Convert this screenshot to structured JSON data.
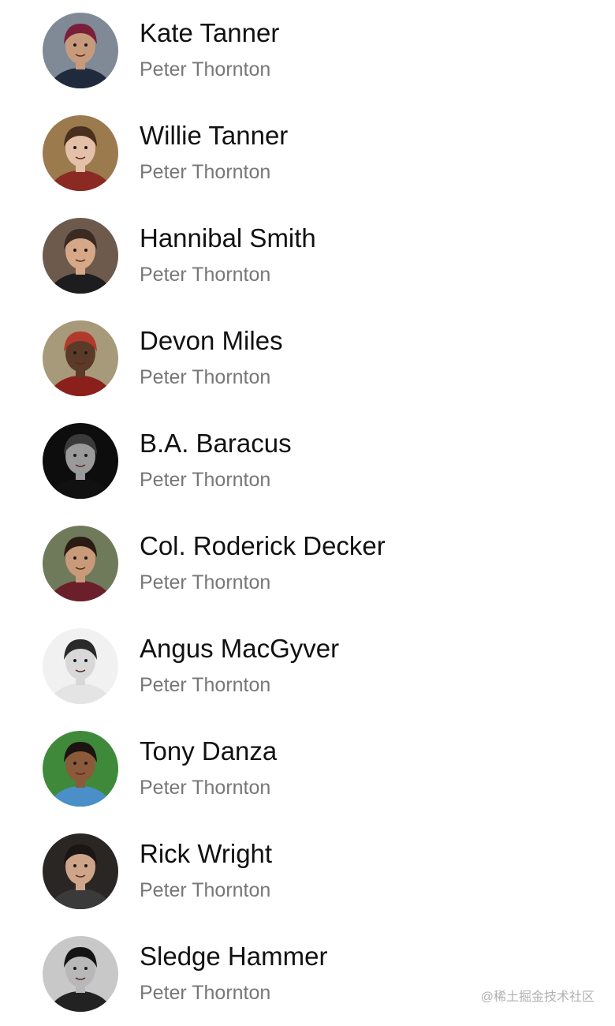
{
  "contacts": [
    {
      "name": "Kate Tanner",
      "subtitle": "Peter Thornton",
      "avatar": {
        "bg": "#7f8a96",
        "skin": "#c89a7c",
        "hair": "#7a1f3a",
        "shirt": "#1f2b3d"
      }
    },
    {
      "name": "Willie Tanner",
      "subtitle": "Peter Thornton",
      "avatar": {
        "bg": "#9b7a4e",
        "skin": "#e5c0a8",
        "hair": "#4a2f1e",
        "shirt": "#8a2a22"
      }
    },
    {
      "name": "Hannibal Smith",
      "subtitle": "Peter Thornton",
      "avatar": {
        "bg": "#6d5a4c",
        "skin": "#d7a888",
        "hair": "#3a2b22",
        "shirt": "#1d1d1f"
      }
    },
    {
      "name": "Devon Miles",
      "subtitle": "Peter Thornton",
      "avatar": {
        "bg": "#a79a7a",
        "skin": "#5c3a28",
        "hair": "#b23a2c",
        "shirt": "#8a1f1c"
      }
    },
    {
      "name": "B.A. Baracus",
      "subtitle": "Peter Thornton",
      "avatar": {
        "bg": "#0d0d0d",
        "skin": "#9a9a9a",
        "hair": "#3a3a3a",
        "shirt": "#111111"
      }
    },
    {
      "name": "Col. Roderick Decker",
      "subtitle": "Peter Thornton",
      "avatar": {
        "bg": "#6f7a5a",
        "skin": "#c99a7a",
        "hair": "#2a1c14",
        "shirt": "#6a1f2a"
      }
    },
    {
      "name": "Angus MacGyver",
      "subtitle": "Peter Thornton",
      "avatar": {
        "bg": "#f1f1f1",
        "skin": "#d8d8d8",
        "hair": "#2a2a2a",
        "shirt": "#e4e4e4"
      }
    },
    {
      "name": "Tony Danza",
      "subtitle": "Peter Thornton",
      "avatar": {
        "bg": "#3f8a3a",
        "skin": "#8a5a3a",
        "hair": "#1c1410",
        "shirt": "#4a8fc8"
      }
    },
    {
      "name": "Rick Wright",
      "subtitle": "Peter Thornton",
      "avatar": {
        "bg": "#2a2624",
        "skin": "#cfa58a",
        "hair": "#1a1614",
        "shirt": "#3a3a3a"
      }
    },
    {
      "name": "Sledge Hammer",
      "subtitle": "Peter Thornton",
      "avatar": {
        "bg": "#c8c8c8",
        "skin": "#b8b8b8",
        "hair": "#141414",
        "shirt": "#222222"
      }
    }
  ],
  "watermark": "@稀土掘金技术社区"
}
